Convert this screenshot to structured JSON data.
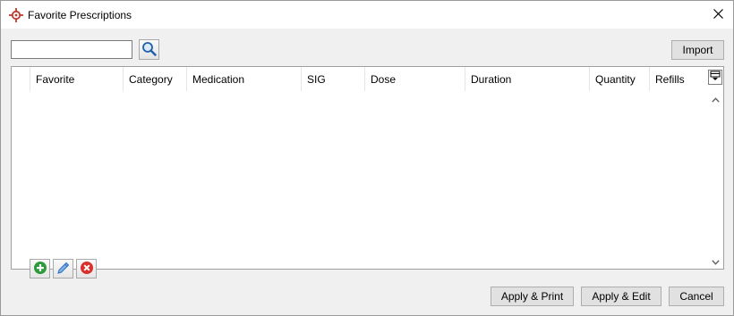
{
  "window": {
    "title": "Favorite Prescriptions",
    "app_icon": "crosshair-target-icon",
    "close_icon": "close-icon"
  },
  "search": {
    "value": "",
    "placeholder": "",
    "button_icon": "magnifier-icon"
  },
  "toolbar": {
    "import_label": "Import"
  },
  "grid": {
    "columns": [
      "Favorite",
      "Category",
      "Medication",
      "SIG",
      "Dose",
      "Duration",
      "Quantity",
      "Refills"
    ],
    "rows": [],
    "column_chooser_icon": "column-chooser-icon"
  },
  "row_actions": {
    "add_icon": "add-icon",
    "edit_icon": "pencil-icon",
    "delete_icon": "delete-icon"
  },
  "footer": {
    "apply_print_label": "Apply & Print",
    "apply_edit_label": "Apply & Edit",
    "cancel_label": "Cancel"
  },
  "colors": {
    "add_green": "#2e9b3a",
    "delete_red": "#d9302c",
    "edit_blue": "#2f6fbf",
    "accent_brand": "#c0392b"
  }
}
